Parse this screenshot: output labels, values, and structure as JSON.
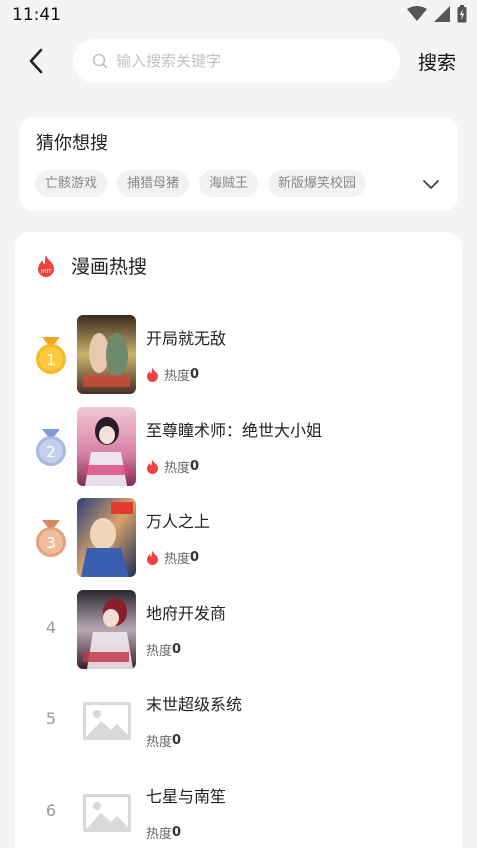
{
  "status_bar": {
    "time": "11:41"
  },
  "search": {
    "placeholder": "输入搜索关键字",
    "submit_label": "搜索"
  },
  "suggestions": {
    "title": "猜你想搜",
    "tags": [
      "亡骸游戏",
      "捕猎母猪",
      "海贼王",
      "新版爆笑校园"
    ]
  },
  "hot_search": {
    "title": "漫画热搜",
    "heat_label": "热度",
    "items": [
      {
        "rank": "1",
        "title": "开局就无敌",
        "heat": "0",
        "cover": "cover-image"
      },
      {
        "rank": "2",
        "title": "至尊瞳术师：绝世大小姐",
        "heat": "0",
        "cover": "cover-image"
      },
      {
        "rank": "3",
        "title": "万人之上",
        "heat": "0",
        "cover": "cover-image"
      },
      {
        "rank": "4",
        "title": "地府开发商",
        "heat": "0",
        "cover": "cover-image"
      },
      {
        "rank": "5",
        "title": "末世超级系统",
        "heat": "0",
        "cover": "image-placeholder-icon"
      },
      {
        "rank": "6",
        "title": "七星与南笙",
        "heat": "0",
        "cover": "image-placeholder-icon"
      }
    ]
  },
  "colors": {
    "accent_flame": "#f0423c",
    "medal_gold": "#f7b928",
    "medal_silver": "#a9b8dc",
    "medal_bronze": "#e3a27a",
    "page_bg": "#f4f4f6"
  }
}
